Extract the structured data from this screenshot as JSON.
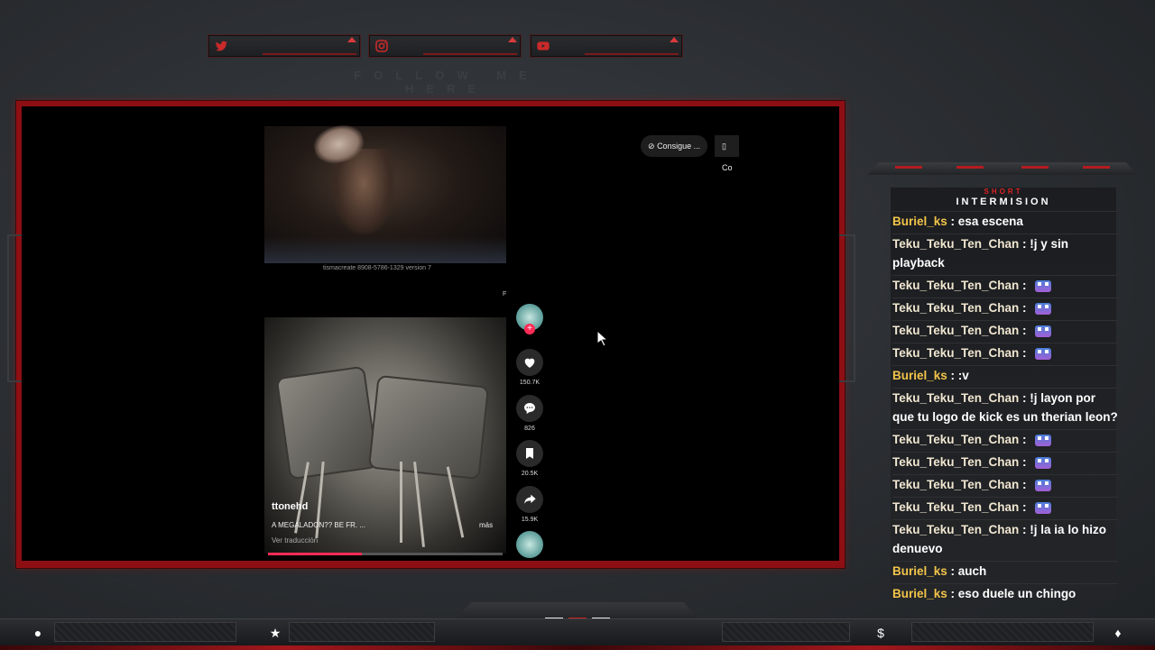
{
  "social": {
    "heading": "FOLLOW ME HERE",
    "items": [
      {
        "name": "twitter-icon"
      },
      {
        "name": "instagram-icon"
      },
      {
        "name": "youtube-icon"
      }
    ]
  },
  "browser": {
    "pill_1": "Consigue ...",
    "pill_2": "Co"
  },
  "video_top": {
    "caption": "tismacreate   8908-5786-1329 version 7",
    "corner_mark": "F"
  },
  "video_main": {
    "author": "ttonehd",
    "description": "A MEGALADON?? BE FR. ...",
    "more": "más",
    "translate": "Ver traducción",
    "progress": 0.4,
    "likes": "150.7K",
    "comments": "826",
    "saves": "20.5K",
    "shares": "15.9K"
  },
  "chat": {
    "title_small": "SHORT",
    "title": "INTERMISION",
    "messages": [
      {
        "user": "Buriel_ks",
        "sep": " : ",
        "text": "esa escena",
        "emote": false
      },
      {
        "user": "Teku_Teku_Ten_Chan",
        "sep": " : ",
        "text": "!j y sin playback",
        "emote": false
      },
      {
        "user": "Teku_Teku_Ten_Chan",
        "sep": " : ",
        "text": "",
        "emote": true
      },
      {
        "user": "Teku_Teku_Ten_Chan",
        "sep": " : ",
        "text": "",
        "emote": true
      },
      {
        "user": "Teku_Teku_Ten_Chan",
        "sep": " : ",
        "text": "",
        "emote": true
      },
      {
        "user": "Teku_Teku_Ten_Chan",
        "sep": " : ",
        "text": "",
        "emote": true
      },
      {
        "user": "Buriel_ks",
        "sep": " : ",
        "text": ":v",
        "emote": false
      },
      {
        "user": "Teku_Teku_Ten_Chan",
        "sep": " : ",
        "text": "!j layon por que tu logo de kick es un therian leon?",
        "emote": false
      },
      {
        "user": "Teku_Teku_Ten_Chan",
        "sep": " : ",
        "text": "",
        "emote": true
      },
      {
        "user": "Teku_Teku_Ten_Chan",
        "sep": " : ",
        "text": "",
        "emote": true
      },
      {
        "user": "Teku_Teku_Ten_Chan",
        "sep": " : ",
        "text": "",
        "emote": true
      },
      {
        "user": "Teku_Teku_Ten_Chan",
        "sep": " : ",
        "text": "",
        "emote": true
      },
      {
        "user": "Teku_Teku_Ten_Chan",
        "sep": " : ",
        "text": "!j la ia lo hizo denuevo",
        "emote": false
      },
      {
        "user": "Buriel_ks",
        "sep": " : ",
        "text": "auch",
        "emote": false
      },
      {
        "user": "Buriel_ks",
        "sep": " : ",
        "text": "eso duele un chingo",
        "emote": false
      }
    ]
  },
  "bottom_bar": {
    "icons": [
      "user-icon",
      "star-icon",
      "dollar-icon",
      "flame-icon"
    ],
    "glyphs": [
      "●",
      "★",
      "$",
      "♦"
    ]
  },
  "colors": {
    "accent": "#b41c1f",
    "tiktok_red": "#fe2c55",
    "chat_user_gold": "#f2c44a"
  }
}
